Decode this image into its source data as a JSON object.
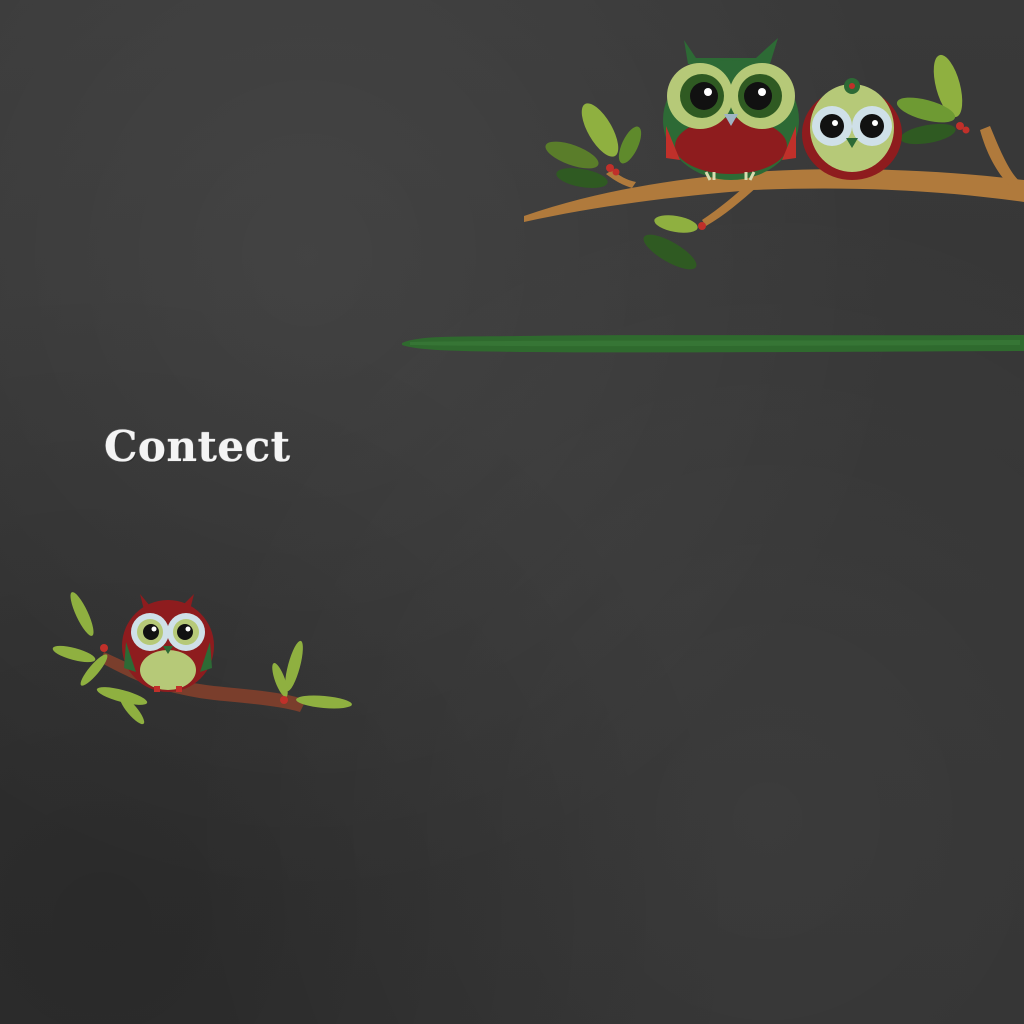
{
  "page": {
    "title": "Contect"
  },
  "decorations": {
    "top_scene": "two-owls-on-branch",
    "bottom_scene": "single-owl-on-branch",
    "stripe": "green-chalk-stripe"
  },
  "colors": {
    "chalkboard": "#363636",
    "stripe_green": "#2f6a2e",
    "owl_green": "#2d6a35",
    "owl_red": "#8e1c1e",
    "owl_lime": "#b6c978",
    "branch_tan": "#b07a3c",
    "branch_brown": "#7a3e2c",
    "leaf_green": "#8fb040",
    "text_white": "#f4f4f4"
  }
}
